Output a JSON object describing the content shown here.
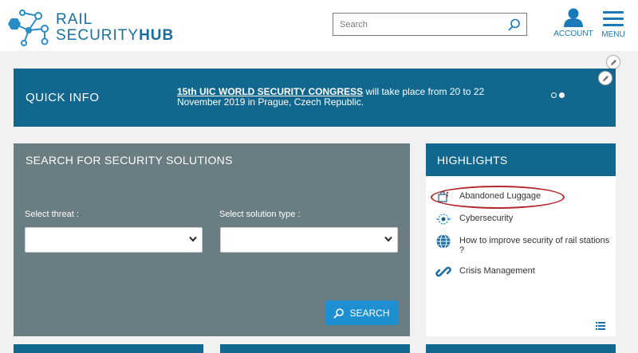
{
  "brand": {
    "line1": "RAIL",
    "line2a": "SECURITY",
    "line2b": "HUB"
  },
  "search": {
    "placeholder": "Search"
  },
  "header": {
    "account_label": "ACCOUNT",
    "menu_label": "MENU"
  },
  "quick_info": {
    "title": "QUICK INFO",
    "link_text": "15th UIC WORLD SECURITY CONGRESS",
    "text": " will take place from 20 to 22 November 2019 in Prague, Czech Republic."
  },
  "search_panel": {
    "title": "SEARCH FOR SECURITY SOLUTIONS",
    "threat_label": "Select threat :",
    "solution_label": "Select solution type :",
    "button_label": "SEARCH"
  },
  "highlights": {
    "title": "HIGHLIGHTS",
    "items": [
      {
        "label": "Abandoned Luggage",
        "icon": "luggage-icon"
      },
      {
        "label": "Cybersecurity",
        "icon": "cyber-icon"
      },
      {
        "label": "How to improve security of rail stations ?",
        "icon": "globe-icon"
      },
      {
        "label": "Crisis Management",
        "icon": "link-icon"
      }
    ]
  },
  "colors": {
    "primary": "#12678f",
    "accent": "#1e8fd0",
    "panel": "#6a7d82",
    "highlight_oval": "#b3282d"
  }
}
